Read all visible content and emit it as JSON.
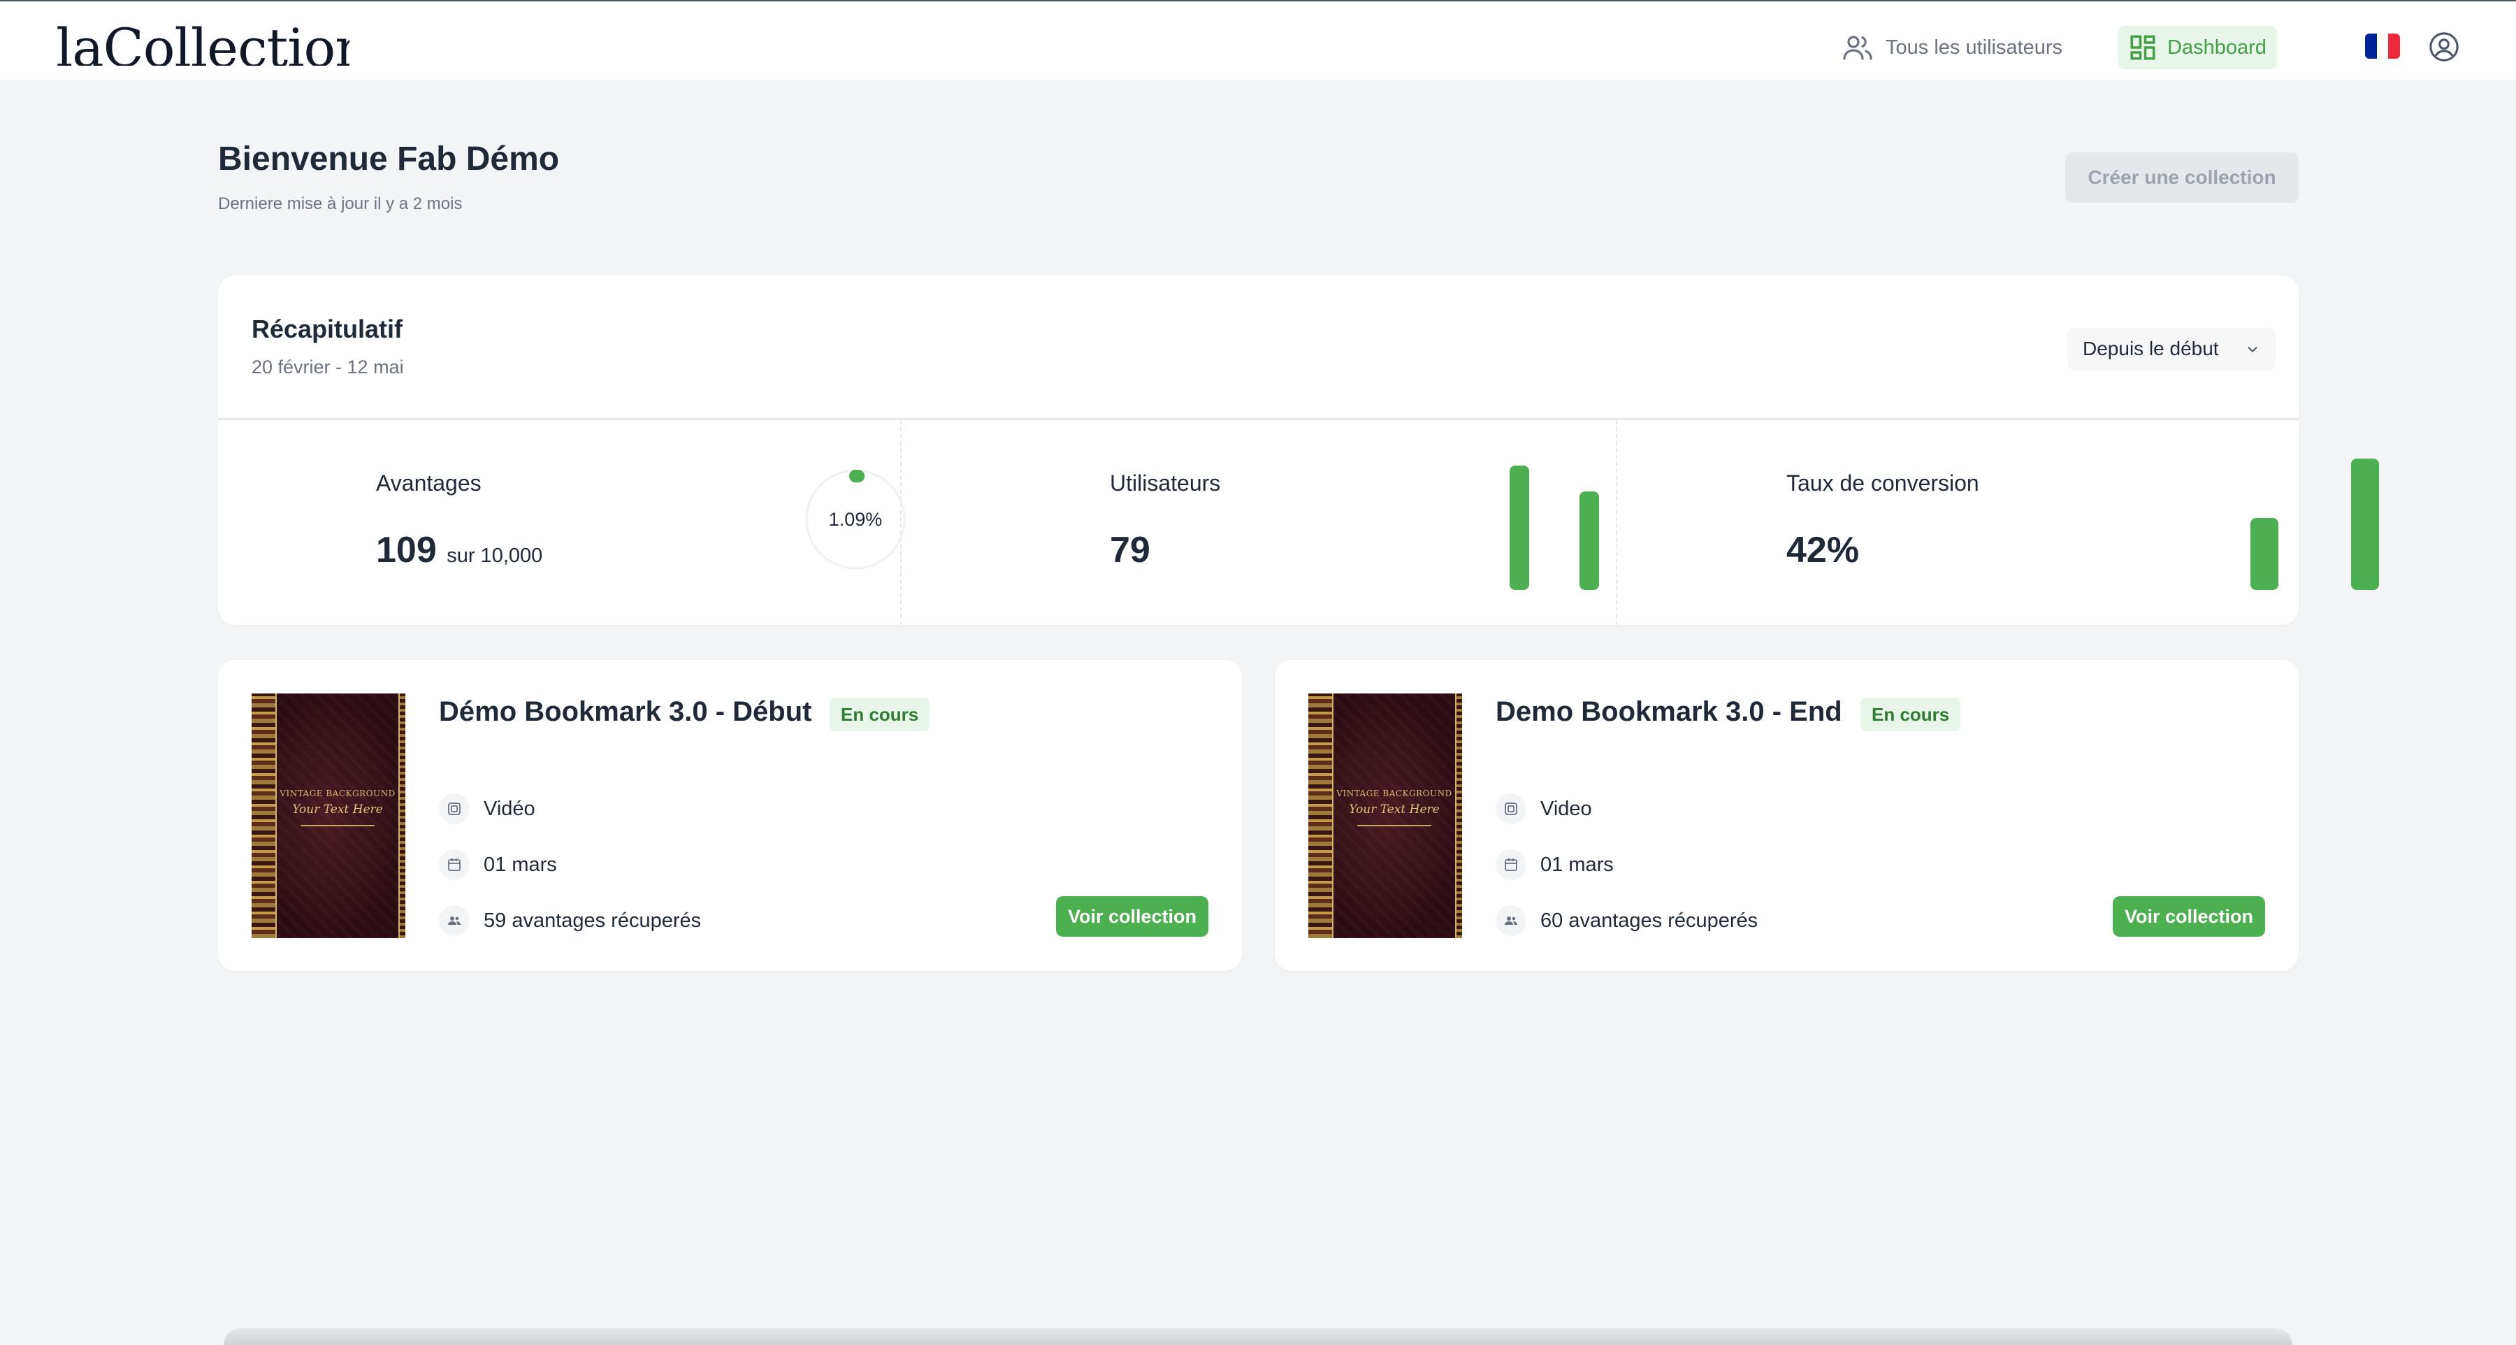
{
  "nav": {
    "logo_text": "laCollection",
    "users_label": "Tous les utilisateurs",
    "dashboard_label": "Dashboard",
    "language": "fr",
    "flag_colors": [
      "#002395",
      "#ffffff",
      "#ed2939"
    ],
    "icons": [
      "users-icon",
      "dashboard-icon",
      "user-circle-icon"
    ]
  },
  "header": {
    "welcome": "Bienvenue Fab Démo",
    "updated": "Derniere mise à jour il y a 2 mois",
    "create_label": "Créer une collection",
    "create_disabled": true
  },
  "summary": {
    "title": "Récapitulatif",
    "range": "20 février - 12 mai",
    "period": "Depuis le début",
    "stats": {
      "perks": {
        "label": "Avantages",
        "value": "109",
        "sub": "sur 10,000",
        "ring_label": "1.09%",
        "ring_fraction": 0.0109
      },
      "users": {
        "label": "Utilisateurs",
        "value": "79",
        "bars": [
          1.0,
          0.79
        ]
      },
      "conversion": {
        "label": "Taux de conversion",
        "value": "42%",
        "bars": [
          0.55,
          1.0
        ]
      }
    }
  },
  "collections": [
    {
      "title": "Démo Bookmark 3.0 - Début",
      "status": "En cours",
      "type": "Vidéo",
      "date": "01 mars",
      "perks": "59 avantages récuperés",
      "button": "Voir collection",
      "cover_title": "VINTAGE BACKGROUND",
      "cover_sub": "Your Text Here"
    },
    {
      "title": "Demo Bookmark 3.0 - End",
      "status": "En cours",
      "type": "Video",
      "date": "01 mars",
      "perks": "60 avantages récuperés",
      "button": "Voir collection",
      "cover_title": "VINTAGE BACKGROUND",
      "cover_sub": "Your Text Here"
    }
  ],
  "colors": {
    "accent": "#4caf50",
    "accent_bg": "#e8f5e9",
    "background": "#f3f4f6"
  }
}
